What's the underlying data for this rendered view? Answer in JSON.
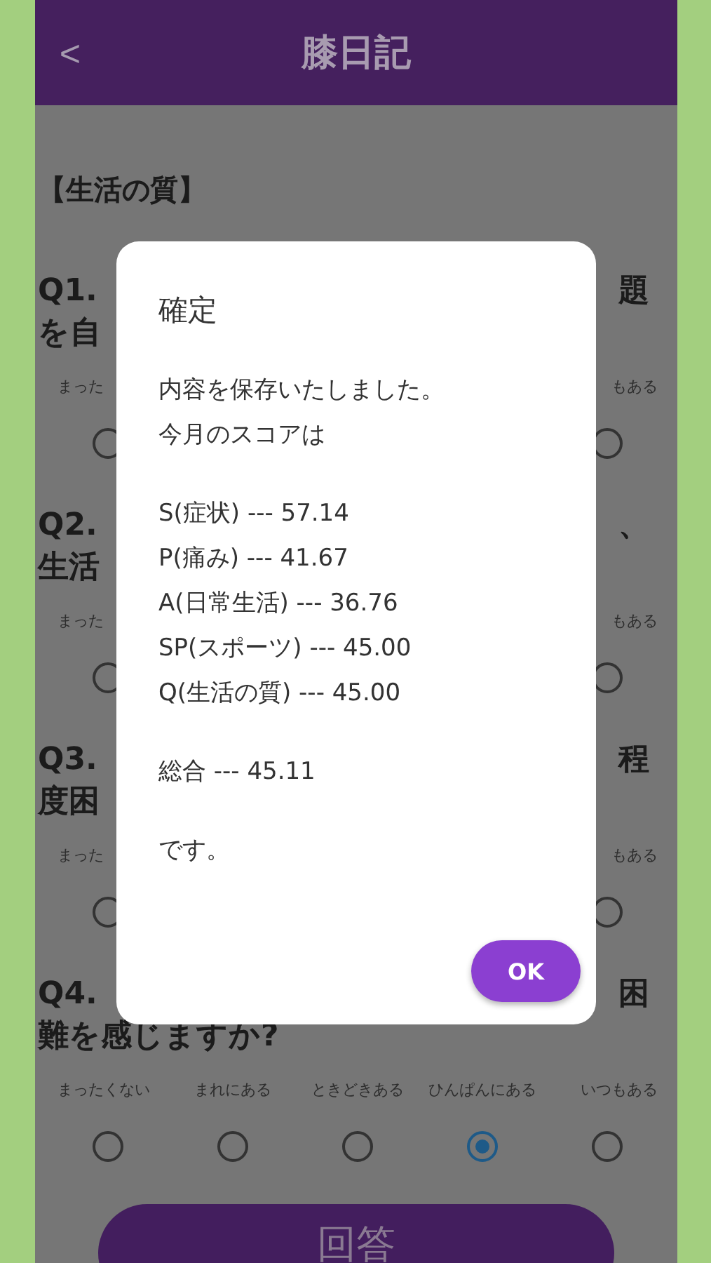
{
  "header": {
    "back_icon": "<",
    "title": "膝日記"
  },
  "section_title": "【生活の質】",
  "questions": [
    {
      "lines": [
        {
          "left": "Q1.",
          "right": "題"
        },
        {
          "left": "を自"
        }
      ],
      "options": [
        {
          "label": "まった",
          "selected": false
        },
        {
          "label": "もある",
          "selected": false
        }
      ]
    },
    {
      "lines": [
        {
          "left": "Q2.",
          "right": "、"
        },
        {
          "left": "生活"
        }
      ],
      "options": [
        {
          "label": "まった",
          "selected": false
        },
        {
          "label": "もある",
          "selected": false
        }
      ]
    },
    {
      "lines": [
        {
          "left": "Q3.",
          "right": "程"
        },
        {
          "left": "度困"
        }
      ],
      "options": [
        {
          "label": "まった",
          "selected": false
        },
        {
          "label": "もある",
          "selected": false
        }
      ]
    },
    {
      "lines": [
        {
          "left": "Q4.",
          "right": "困"
        },
        {
          "left": "難を感じますか?"
        }
      ],
      "options": [
        {
          "label": "まったくない",
          "selected": false
        },
        {
          "label": "まれにある",
          "selected": false
        },
        {
          "label": "ときどきある",
          "selected": false
        },
        {
          "label": "ひんぱんにある",
          "selected": true
        },
        {
          "label": "いつもある",
          "selected": false
        }
      ]
    }
  ],
  "submit_button": "回答",
  "dialog": {
    "title": "確定",
    "paragraphs": [
      [
        "内容を保存いたしました。",
        "今月のスコアは"
      ],
      [
        "S(症状) --- 57.14",
        "P(痛み) --- 41.67",
        "A(日常生活) --- 36.76",
        "SP(スポーツ) --- 45.00",
        "Q(生活の質) --- 45.00"
      ],
      [
        "総合 --- 45.11"
      ],
      [
        "です。"
      ]
    ],
    "button": "OK"
  }
}
